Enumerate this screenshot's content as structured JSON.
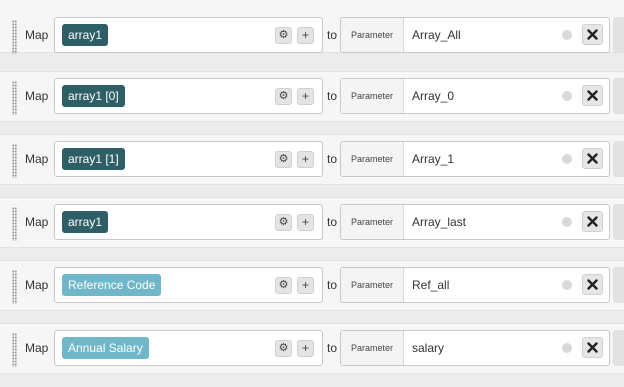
{
  "rows": [
    {
      "map_label": "Map",
      "source": "array1",
      "chip_style": "dark",
      "to_label": "to",
      "param_tag": "Parameter",
      "param_value": "Array_All"
    },
    {
      "map_label": "Map",
      "source": "array1 [0]",
      "chip_style": "dark",
      "to_label": "to",
      "param_tag": "Parameter",
      "param_value": "Array_0"
    },
    {
      "map_label": "Map",
      "source": "array1 [1]",
      "chip_style": "dark",
      "to_label": "to",
      "param_tag": "Parameter",
      "param_value": "Array_1"
    },
    {
      "map_label": "Map",
      "source": "array1",
      "chip_style": "dark",
      "to_label": "to",
      "param_tag": "Parameter",
      "param_value": "Array_last"
    },
    {
      "map_label": "Map",
      "source": "Reference Code",
      "chip_style": "light",
      "to_label": "to",
      "param_tag": "Parameter",
      "param_value": "Ref_all"
    },
    {
      "map_label": "Map",
      "source": "Annual Salary",
      "chip_style": "light",
      "to_label": "to",
      "param_tag": "Parameter",
      "param_value": "salary"
    }
  ],
  "icons": {
    "settings": "gear-icon",
    "add": "plus-icon",
    "remove": "close-icon",
    "drag": "drag-handle-icon",
    "info": "info-dot-icon"
  },
  "colors": {
    "chip_dark": "#2f5f66",
    "chip_light": "#6fb7c9",
    "row_bg": "#f6f6f6",
    "page_bg": "#ececec"
  }
}
